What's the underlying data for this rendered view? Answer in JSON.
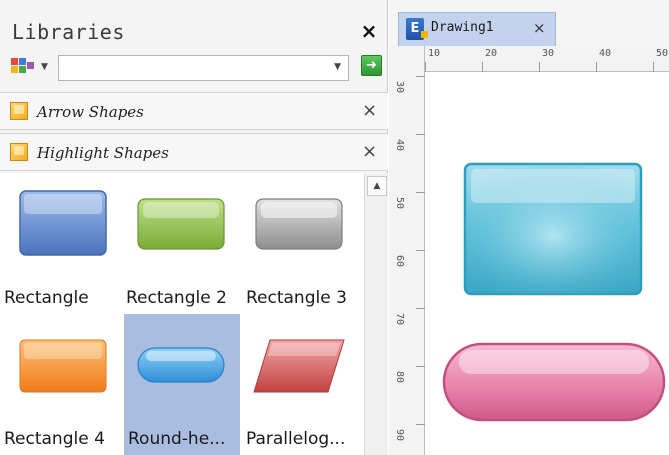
{
  "libraries": {
    "title": "Libraries",
    "close_icon": "×",
    "go_icon": "➜",
    "combo_value": "",
    "categories": [
      {
        "label": "Arrow Shapes",
        "close": "×"
      },
      {
        "label": "Highlight Shapes",
        "close": "×"
      }
    ],
    "shapes": [
      {
        "label": "Rectangle",
        "icon": "rectangle-blue-icon",
        "color": "#5b86cc"
      },
      {
        "label": "Rectangle 2",
        "icon": "rectangle-green-icon",
        "color": "#8cbb48"
      },
      {
        "label": "Rectangle 3",
        "icon": "rectangle-gray-icon",
        "color": "#a8a8a8"
      },
      {
        "label": "Rectangle 4",
        "icon": "rectangle-orange-icon",
        "color": "#f6922e"
      },
      {
        "label": "Round-he...",
        "icon": "round-head-icon",
        "color": "#3fa6e4",
        "selected": true
      },
      {
        "label": "Parallelog...",
        "icon": "parallelogram-icon",
        "color": "#d25a5a"
      }
    ]
  },
  "document": {
    "tab_label": "Drawing1",
    "tab_close": "×",
    "ruler_top": [
      "10",
      "20",
      "30",
      "40",
      "50"
    ],
    "ruler_left": [
      "30",
      "40",
      "50",
      "60",
      "70",
      "80",
      "90"
    ]
  },
  "colors": {
    "selection": "#a9bde1",
    "tab_active": "#c3d3ee",
    "canvas_rect": "#4fb6d1",
    "canvas_pill": "#e5739e"
  }
}
